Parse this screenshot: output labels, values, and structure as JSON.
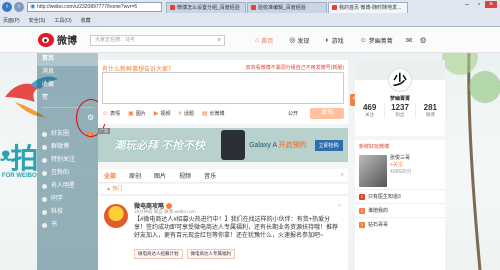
{
  "browser": {
    "url": "http://weibo.com/u/2320897777/home?wvr=5",
    "tabs": [
      {
        "label": "微博怎么设置分组_百度经验"
      },
      {
        "label": "验收准编辑_百度经验"
      },
      {
        "label": "我的首页 微博-随时随地发..."
      }
    ],
    "menu": [
      "页面(P)",
      "安全(S)",
      "工具(O)",
      "收藏"
    ]
  },
  "weibo": {
    "logo_text": "微博",
    "search_placeholder": "大家正在搜：马可",
    "nav": {
      "home": "首页",
      "discover": "发现",
      "game": "游戏",
      "user": "梦幽菁菁"
    }
  },
  "leftnav": {
    "items": [
      {
        "label": "首页"
      },
      {
        "label": "消息"
      },
      {
        "label": "收藏"
      },
      {
        "label": "赞"
      }
    ],
    "groups": [
      {
        "label": "好友圈",
        "badge": "1"
      },
      {
        "label": "群微博"
      },
      {
        "label": "特别关注"
      },
      {
        "label": "互粉的"
      },
      {
        "label": "名人明星"
      },
      {
        "label": "同学"
      },
      {
        "label": "科技"
      },
      {
        "label": "书"
      }
    ]
  },
  "compose": {
    "prompt": "有什么新鲜事想告诉大家？",
    "hot_hint": "双向看微博不漏洞分组自己不用发微号(新版)",
    "tools": [
      "表情",
      "图片",
      "视频",
      "话题",
      "长微博"
    ],
    "public": "公开",
    "send": "发布"
  },
  "banner": {
    "ad": "广告",
    "slogan": "潮玩必拜 不抢不快",
    "galaxy": "Galaxy A",
    "galaxy_suffix": "开启预约",
    "button": "立即抢购"
  },
  "feed": {
    "tabs": [
      "全部",
      "原创",
      "图片",
      "视频",
      "音乐"
    ],
    "hot": "热门",
    "post": {
      "name": "微电商攻略",
      "meta": "16分钟前 来自 微博 weibo.com",
      "text": "【#微电商达人#招募火热进行中！】我们在找这样的小伙伴：有货+热爱分享！签约成功即可享受微电商达人专属福利，还有长期业务资源扶持哦！推荐好友加入，更有百元现金红包等你拿！还在犹豫什么，火速报名参加吧~",
      "tags": [
        "微电商达人招募计划",
        "微电商达人专属福利"
      ]
    }
  },
  "profile": {
    "avatar_char": "少",
    "name": "梦幽菁菁",
    "stats": [
      {
        "value": "469",
        "label": "关注"
      },
      {
        "value": "1237",
        "label": "粉丝"
      },
      {
        "value": "281",
        "label": "微博"
      }
    ]
  },
  "recommend": {
    "head": "新鲜好玩微博",
    "hot_name": "张俊三哥",
    "hot_fans": "436690分",
    "add": "+关注",
    "ranks": [
      {
        "n": "1",
        "label": "只有医生知道3"
      },
      {
        "n": "2",
        "label": "谁陪我的"
      },
      {
        "n": "3",
        "label": "钻石哥哥"
      }
    ]
  }
}
